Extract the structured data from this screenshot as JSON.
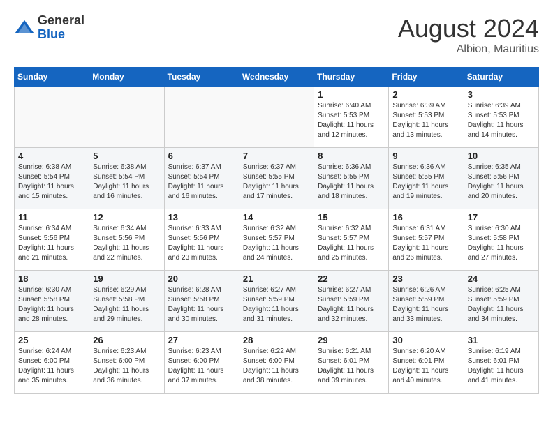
{
  "header": {
    "logo_general": "General",
    "logo_blue": "Blue",
    "month_title": "August 2024",
    "location": "Albion, Mauritius"
  },
  "days_of_week": [
    "Sunday",
    "Monday",
    "Tuesday",
    "Wednesday",
    "Thursday",
    "Friday",
    "Saturday"
  ],
  "weeks": [
    [
      {
        "day": "",
        "sunrise": "",
        "sunset": "",
        "daylight": "",
        "empty": true
      },
      {
        "day": "",
        "sunrise": "",
        "sunset": "",
        "daylight": "",
        "empty": true
      },
      {
        "day": "",
        "sunrise": "",
        "sunset": "",
        "daylight": "",
        "empty": true
      },
      {
        "day": "",
        "sunrise": "",
        "sunset": "",
        "daylight": "",
        "empty": true
      },
      {
        "day": "1",
        "sunrise": "Sunrise: 6:40 AM",
        "sunset": "Sunset: 5:53 PM",
        "daylight": "Daylight: 11 hours and 12 minutes.",
        "empty": false
      },
      {
        "day": "2",
        "sunrise": "Sunrise: 6:39 AM",
        "sunset": "Sunset: 5:53 PM",
        "daylight": "Daylight: 11 hours and 13 minutes.",
        "empty": false
      },
      {
        "day": "3",
        "sunrise": "Sunrise: 6:39 AM",
        "sunset": "Sunset: 5:53 PM",
        "daylight": "Daylight: 11 hours and 14 minutes.",
        "empty": false
      }
    ],
    [
      {
        "day": "4",
        "sunrise": "Sunrise: 6:38 AM",
        "sunset": "Sunset: 5:54 PM",
        "daylight": "Daylight: 11 hours and 15 minutes.",
        "empty": false
      },
      {
        "day": "5",
        "sunrise": "Sunrise: 6:38 AM",
        "sunset": "Sunset: 5:54 PM",
        "daylight": "Daylight: 11 hours and 16 minutes.",
        "empty": false
      },
      {
        "day": "6",
        "sunrise": "Sunrise: 6:37 AM",
        "sunset": "Sunset: 5:54 PM",
        "daylight": "Daylight: 11 hours and 16 minutes.",
        "empty": false
      },
      {
        "day": "7",
        "sunrise": "Sunrise: 6:37 AM",
        "sunset": "Sunset: 5:55 PM",
        "daylight": "Daylight: 11 hours and 17 minutes.",
        "empty": false
      },
      {
        "day": "8",
        "sunrise": "Sunrise: 6:36 AM",
        "sunset": "Sunset: 5:55 PM",
        "daylight": "Daylight: 11 hours and 18 minutes.",
        "empty": false
      },
      {
        "day": "9",
        "sunrise": "Sunrise: 6:36 AM",
        "sunset": "Sunset: 5:55 PM",
        "daylight": "Daylight: 11 hours and 19 minutes.",
        "empty": false
      },
      {
        "day": "10",
        "sunrise": "Sunrise: 6:35 AM",
        "sunset": "Sunset: 5:56 PM",
        "daylight": "Daylight: 11 hours and 20 minutes.",
        "empty": false
      }
    ],
    [
      {
        "day": "11",
        "sunrise": "Sunrise: 6:34 AM",
        "sunset": "Sunset: 5:56 PM",
        "daylight": "Daylight: 11 hours and 21 minutes.",
        "empty": false
      },
      {
        "day": "12",
        "sunrise": "Sunrise: 6:34 AM",
        "sunset": "Sunset: 5:56 PM",
        "daylight": "Daylight: 11 hours and 22 minutes.",
        "empty": false
      },
      {
        "day": "13",
        "sunrise": "Sunrise: 6:33 AM",
        "sunset": "Sunset: 5:56 PM",
        "daylight": "Daylight: 11 hours and 23 minutes.",
        "empty": false
      },
      {
        "day": "14",
        "sunrise": "Sunrise: 6:32 AM",
        "sunset": "Sunset: 5:57 PM",
        "daylight": "Daylight: 11 hours and 24 minutes.",
        "empty": false
      },
      {
        "day": "15",
        "sunrise": "Sunrise: 6:32 AM",
        "sunset": "Sunset: 5:57 PM",
        "daylight": "Daylight: 11 hours and 25 minutes.",
        "empty": false
      },
      {
        "day": "16",
        "sunrise": "Sunrise: 6:31 AM",
        "sunset": "Sunset: 5:57 PM",
        "daylight": "Daylight: 11 hours and 26 minutes.",
        "empty": false
      },
      {
        "day": "17",
        "sunrise": "Sunrise: 6:30 AM",
        "sunset": "Sunset: 5:58 PM",
        "daylight": "Daylight: 11 hours and 27 minutes.",
        "empty": false
      }
    ],
    [
      {
        "day": "18",
        "sunrise": "Sunrise: 6:30 AM",
        "sunset": "Sunset: 5:58 PM",
        "daylight": "Daylight: 11 hours and 28 minutes.",
        "empty": false
      },
      {
        "day": "19",
        "sunrise": "Sunrise: 6:29 AM",
        "sunset": "Sunset: 5:58 PM",
        "daylight": "Daylight: 11 hours and 29 minutes.",
        "empty": false
      },
      {
        "day": "20",
        "sunrise": "Sunrise: 6:28 AM",
        "sunset": "Sunset: 5:58 PM",
        "daylight": "Daylight: 11 hours and 30 minutes.",
        "empty": false
      },
      {
        "day": "21",
        "sunrise": "Sunrise: 6:27 AM",
        "sunset": "Sunset: 5:59 PM",
        "daylight": "Daylight: 11 hours and 31 minutes.",
        "empty": false
      },
      {
        "day": "22",
        "sunrise": "Sunrise: 6:27 AM",
        "sunset": "Sunset: 5:59 PM",
        "daylight": "Daylight: 11 hours and 32 minutes.",
        "empty": false
      },
      {
        "day": "23",
        "sunrise": "Sunrise: 6:26 AM",
        "sunset": "Sunset: 5:59 PM",
        "daylight": "Daylight: 11 hours and 33 minutes.",
        "empty": false
      },
      {
        "day": "24",
        "sunrise": "Sunrise: 6:25 AM",
        "sunset": "Sunset: 5:59 PM",
        "daylight": "Daylight: 11 hours and 34 minutes.",
        "empty": false
      }
    ],
    [
      {
        "day": "25",
        "sunrise": "Sunrise: 6:24 AM",
        "sunset": "Sunset: 6:00 PM",
        "daylight": "Daylight: 11 hours and 35 minutes.",
        "empty": false
      },
      {
        "day": "26",
        "sunrise": "Sunrise: 6:23 AM",
        "sunset": "Sunset: 6:00 PM",
        "daylight": "Daylight: 11 hours and 36 minutes.",
        "empty": false
      },
      {
        "day": "27",
        "sunrise": "Sunrise: 6:23 AM",
        "sunset": "Sunset: 6:00 PM",
        "daylight": "Daylight: 11 hours and 37 minutes.",
        "empty": false
      },
      {
        "day": "28",
        "sunrise": "Sunrise: 6:22 AM",
        "sunset": "Sunset: 6:00 PM",
        "daylight": "Daylight: 11 hours and 38 minutes.",
        "empty": false
      },
      {
        "day": "29",
        "sunrise": "Sunrise: 6:21 AM",
        "sunset": "Sunset: 6:01 PM",
        "daylight": "Daylight: 11 hours and 39 minutes.",
        "empty": false
      },
      {
        "day": "30",
        "sunrise": "Sunrise: 6:20 AM",
        "sunset": "Sunset: 6:01 PM",
        "daylight": "Daylight: 11 hours and 40 minutes.",
        "empty": false
      },
      {
        "day": "31",
        "sunrise": "Sunrise: 6:19 AM",
        "sunset": "Sunset: 6:01 PM",
        "daylight": "Daylight: 11 hours and 41 minutes.",
        "empty": false
      }
    ]
  ]
}
